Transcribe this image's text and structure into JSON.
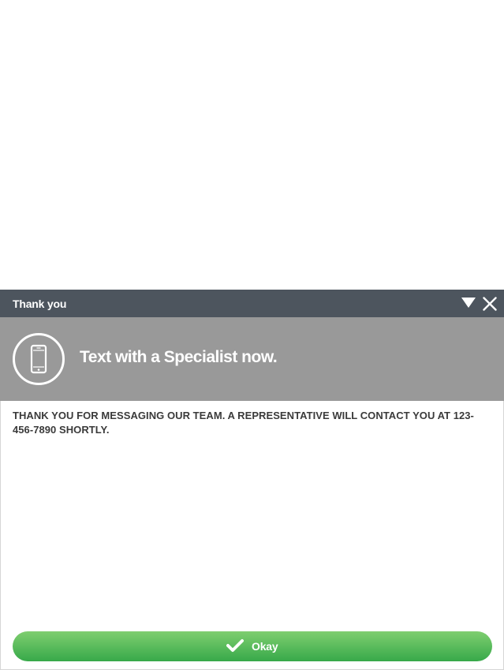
{
  "dialog": {
    "title": "Thank you",
    "banner_headline": "Text with a Specialist now.",
    "message": "THANK YOU FOR MESSAGING OUR TEAM. A REPRESENTATIVE WILL CONTACT YOU AT 123-456-7890 SHORTLY.",
    "okay_label": "Okay"
  },
  "icons": {
    "minimize": "triangle-down-icon",
    "close": "close-icon",
    "banner": "smartphone-icon",
    "okay": "checkmark-icon"
  },
  "colors": {
    "titlebar": "#4d555e",
    "banner": "#999999",
    "text": "#3a3a3a",
    "button_top": "#7fce70",
    "button_bottom": "#37a94a"
  }
}
